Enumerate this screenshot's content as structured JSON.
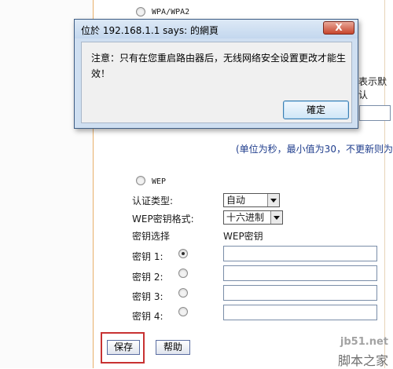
{
  "wpa": {
    "label": "WPA/WPA2"
  },
  "background": {
    "fragment_right1": "表示默认",
    "note_unit": "(单位为秒，最小值为30，不更新则为"
  },
  "wep": {
    "label": "WEP",
    "auth_label": "认证类型:",
    "auth_value": "自动",
    "format_label": "WEP密钥格式:",
    "format_value": "十六进制",
    "key_select_label": "密钥选择",
    "key_col_label": "WEP密钥",
    "keys": [
      {
        "label": "密钥 1:",
        "checked": true
      },
      {
        "label": "密钥 2:",
        "checked": false
      },
      {
        "label": "密钥 3:",
        "checked": false
      },
      {
        "label": "密钥 4:",
        "checked": false
      }
    ]
  },
  "actions": {
    "save": "保存",
    "help": "帮助"
  },
  "dialog": {
    "title": "位於 192.168.1.1 says: 的網頁",
    "close": "X",
    "message": "注意：只有在您重启路由器后，无线网络安全设置更改才能生效！",
    "ok": "確定"
  },
  "watermark": {
    "site": "jb51.net",
    "brand": "脚本之家"
  }
}
